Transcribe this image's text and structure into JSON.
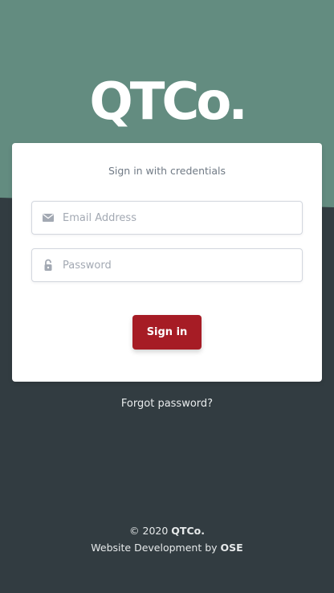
{
  "brand": {
    "logo_text": "QTCo."
  },
  "login": {
    "title": "Sign in with credentials",
    "email_placeholder": "Email Address",
    "password_placeholder": "Password",
    "signin_label": "Sign in",
    "email_icon": "envelope-icon",
    "password_icon": "lock-open-icon"
  },
  "links": {
    "forgot_password": "Forgot password?"
  },
  "footer": {
    "copyright": "© 2020",
    "company": "QTCo.",
    "dev_prefix": "Website Development by",
    "dev_company": "OSE"
  },
  "colors": {
    "top_background": "#638c80",
    "bottom_background": "#323c41",
    "card_background": "#ffffff",
    "primary_button": "#a61c25",
    "placeholder_text": "#a3a9b3"
  }
}
